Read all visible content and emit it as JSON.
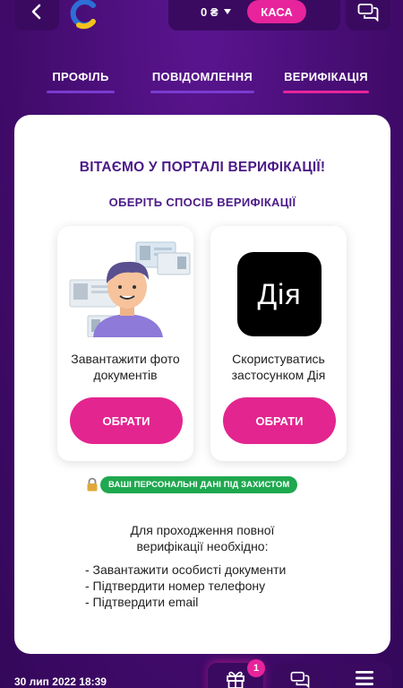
{
  "header": {
    "balance": "0 ₴",
    "kasa_label": "КАСА"
  },
  "tabs": [
    {
      "label": "ПРОФІЛЬ"
    },
    {
      "label": "ПОВІДОМЛЕННЯ"
    },
    {
      "label": "ВЕРИФІКАЦІЯ"
    }
  ],
  "main": {
    "welcome": "ВІТАЄМО У ПОРТАЛІ ВЕРИФІКАЦІЇ!",
    "choose": "ОБЕРІТЬ СПОСІБ ВЕРИФІКАЦІЇ",
    "options": [
      {
        "text_line1": "Завантажити фото",
        "text_line2": "документів",
        "button": "ОБРАТИ"
      },
      {
        "logo_text": "Дія",
        "text_line1": "Скористуватись",
        "text_line2": "застосунком Дія",
        "button": "ОБРАТИ"
      }
    ],
    "secure_badge": "ВАШІ ПЕРСОНАЛЬНІ ДАНІ ПІД ЗАХИСТОМ",
    "requirements_title_line1": "Для проходження повної",
    "requirements_title_line2": "верифікації необхідно:",
    "requirements": [
      "- Завантажити особисті документи",
      "- Підтвердити номер телефону",
      "- Підтвердити email"
    ]
  },
  "footer": {
    "datetime": "30 лип 2022 18:39",
    "gift_badge": "1"
  },
  "colors": {
    "background": "#4a0b78",
    "accent": "#e7249b",
    "title": "#4b1b87",
    "secure": "#1fa84f"
  }
}
